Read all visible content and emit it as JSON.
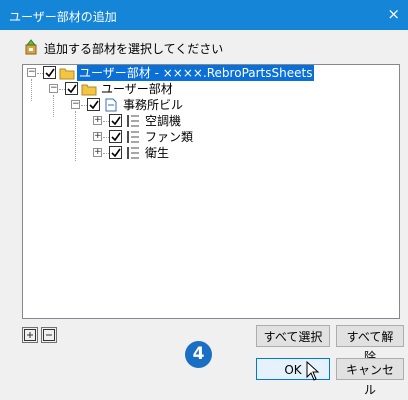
{
  "window": {
    "title": "ユーザー部材の追加",
    "close_glyph": "×"
  },
  "header": {
    "label": "追加する部材を選択してください"
  },
  "tree": [
    {
      "label": "ユーザー部材 - ××××.RebroPartsSheets",
      "selected": true
    },
    {
      "label": "ユーザー部材"
    },
    {
      "label": "事務所ビル"
    },
    {
      "label": "空調機"
    },
    {
      "label": "ファン類"
    },
    {
      "label": "衛生"
    }
  ],
  "buttons": {
    "expand_all": "+",
    "collapse_all": "−",
    "select_all": "すべて選択",
    "deselect_all": "すべて解除",
    "ok": "OK",
    "cancel": "キャンセル"
  },
  "step_badge": "4",
  "colors": {
    "titlebar": "#1585d8",
    "selection": "#0a6fd6",
    "badge": "#1a6fc4"
  }
}
